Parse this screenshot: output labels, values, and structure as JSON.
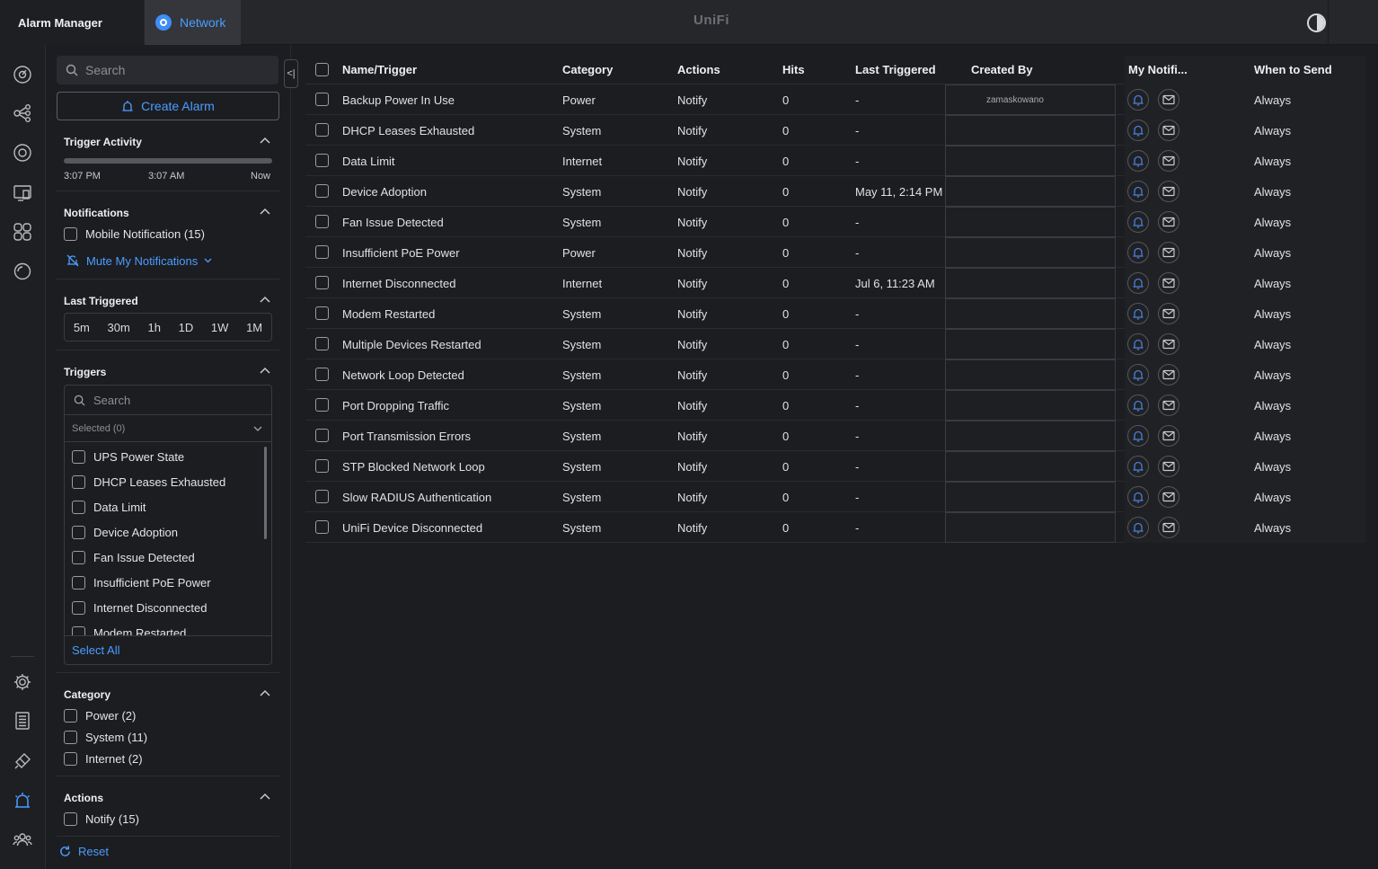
{
  "topbar": {
    "app_title": "Alarm Manager",
    "tab_label": "Network",
    "brand": "UniFi"
  },
  "sidebar": {
    "search_placeholder": "Search",
    "create_label": "Create Alarm",
    "trigger_activity": {
      "title": "Trigger Activity",
      "start": "3:07 PM",
      "mid": "3:07 AM",
      "end": "Now"
    },
    "notifications": {
      "title": "Notifications",
      "mobile_label": "Mobile Notification (15)",
      "mute_label": "Mute My Notifications"
    },
    "last_triggered": {
      "title": "Last Triggered",
      "options": [
        "5m",
        "30m",
        "1h",
        "1D",
        "1W",
        "1M"
      ]
    },
    "triggers": {
      "title": "Triggers",
      "search_placeholder": "Search",
      "selected_label": "Selected (0)",
      "items": [
        "UPS Power State",
        "DHCP Leases Exhausted",
        "Data Limit",
        "Device Adoption",
        "Fan Issue Detected",
        "Insufficient PoE Power",
        "Internet Disconnected",
        "Modem Restarted"
      ],
      "select_all": "Select All"
    },
    "category": {
      "title": "Category",
      "items": [
        "Power (2)",
        "System (11)",
        "Internet (2)"
      ]
    },
    "actions": {
      "title": "Actions",
      "items": [
        "Notify (15)"
      ]
    },
    "reset_label": "Reset"
  },
  "table": {
    "headers": {
      "name": "Name/Trigger",
      "category": "Category",
      "actions": "Actions",
      "hits": "Hits",
      "last_triggered": "Last Triggered",
      "created_by": "Created By",
      "my_notif": "My Notifi...",
      "when": "When to Send"
    },
    "rows": [
      {
        "name": "Backup Power In Use",
        "category": "Power",
        "action": "Notify",
        "hits": "0",
        "last": "-",
        "created_by": "zamaskowano",
        "when": "Always"
      },
      {
        "name": "DHCP Leases Exhausted",
        "category": "System",
        "action": "Notify",
        "hits": "0",
        "last": "-",
        "created_by": "",
        "when": "Always"
      },
      {
        "name": "Data Limit",
        "category": "Internet",
        "action": "Notify",
        "hits": "0",
        "last": "-",
        "created_by": "",
        "when": "Always"
      },
      {
        "name": "Device Adoption",
        "category": "System",
        "action": "Notify",
        "hits": "0",
        "last": "May 11, 2:14 PM",
        "created_by": "",
        "when": "Always"
      },
      {
        "name": "Fan Issue Detected",
        "category": "System",
        "action": "Notify",
        "hits": "0",
        "last": "-",
        "created_by": "",
        "when": "Always"
      },
      {
        "name": "Insufficient PoE Power",
        "category": "Power",
        "action": "Notify",
        "hits": "0",
        "last": "-",
        "created_by": "",
        "when": "Always"
      },
      {
        "name": "Internet Disconnected",
        "category": "Internet",
        "action": "Notify",
        "hits": "0",
        "last": "Jul 6, 11:23 AM",
        "created_by": "",
        "when": "Always"
      },
      {
        "name": "Modem Restarted",
        "category": "System",
        "action": "Notify",
        "hits": "0",
        "last": "-",
        "created_by": "",
        "when": "Always"
      },
      {
        "name": "Multiple Devices Restarted",
        "category": "System",
        "action": "Notify",
        "hits": "0",
        "last": "-",
        "created_by": "",
        "when": "Always"
      },
      {
        "name": "Network Loop Detected",
        "category": "System",
        "action": "Notify",
        "hits": "0",
        "last": "-",
        "created_by": "",
        "when": "Always"
      },
      {
        "name": "Port Dropping Traffic",
        "category": "System",
        "action": "Notify",
        "hits": "0",
        "last": "-",
        "created_by": "",
        "when": "Always"
      },
      {
        "name": "Port Transmission Errors",
        "category": "System",
        "action": "Notify",
        "hits": "0",
        "last": "-",
        "created_by": "",
        "when": "Always"
      },
      {
        "name": "STP Blocked Network Loop",
        "category": "System",
        "action": "Notify",
        "hits": "0",
        "last": "-",
        "created_by": "",
        "when": "Always"
      },
      {
        "name": "Slow RADIUS Authentication",
        "category": "System",
        "action": "Notify",
        "hits": "0",
        "last": "-",
        "created_by": "",
        "when": "Always"
      },
      {
        "name": "UniFi Device Disconnected",
        "category": "System",
        "action": "Notify",
        "hits": "0",
        "last": "-",
        "created_by": "",
        "when": "Always"
      }
    ]
  },
  "colors": {
    "accent": "#4a9dff",
    "background": "#1c1d21",
    "bell": "#4a7fd4"
  }
}
